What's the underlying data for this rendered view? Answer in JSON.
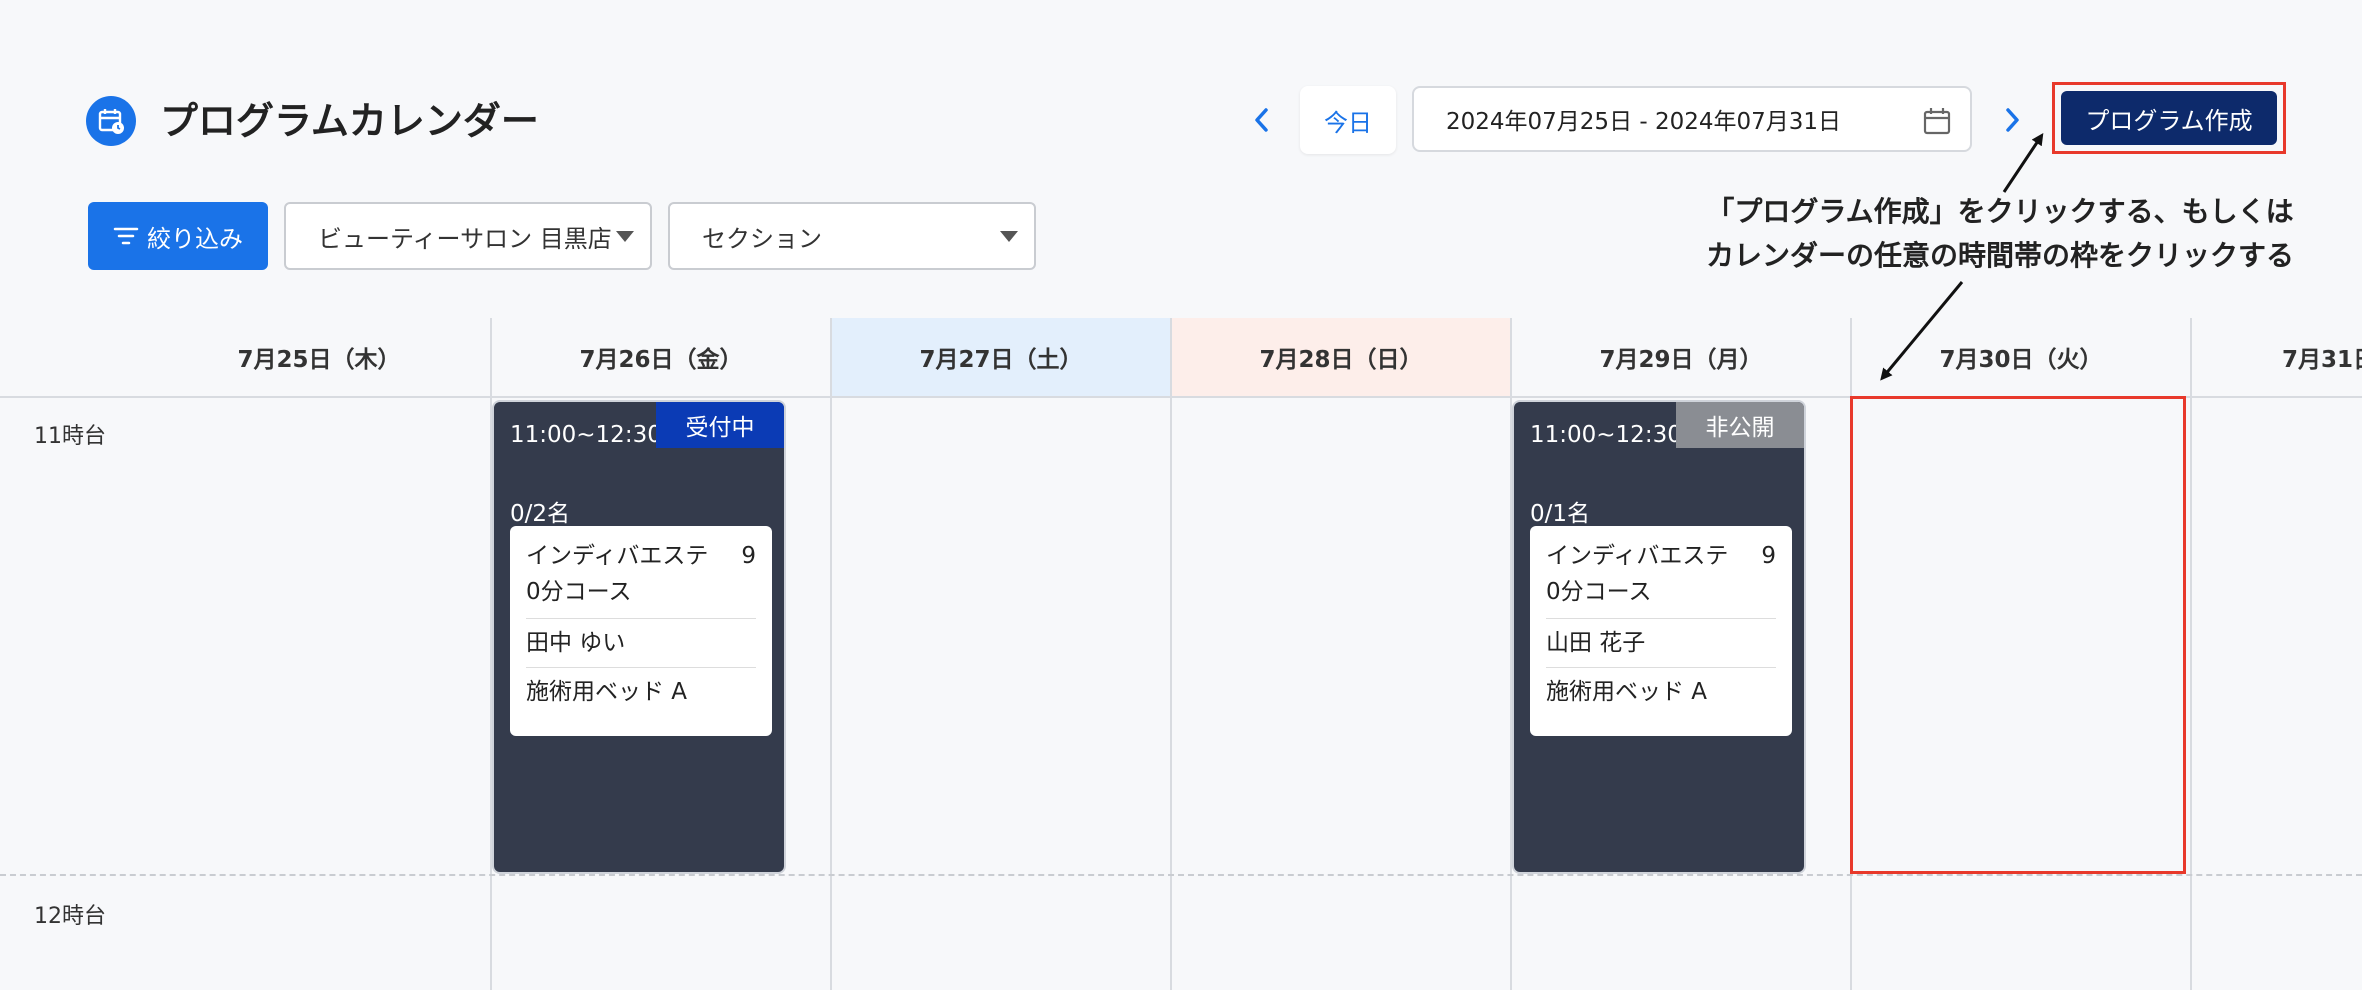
{
  "header": {
    "title": "プログラムカレンダー",
    "today_label": "今日",
    "date_range": "2024年07月25日 - 2024年07月31日",
    "create_label": "プログラム作成"
  },
  "filters": {
    "filter_label": "絞り込み",
    "store": "ビューティーサロン 目黒店",
    "section": "セクション"
  },
  "annotation": {
    "line1": "「プログラム作成」をクリックする、もしくは",
    "line2": "カレンダーの任意の時間帯の枠をクリックする"
  },
  "calendar": {
    "days": [
      "7月25日（木）",
      "7月26日（金）",
      "7月27日（土）",
      "7月28日（日）",
      "7月29日（月）",
      "7月30日（火）",
      "7月31日"
    ],
    "hours": [
      "11時台",
      "12時台"
    ],
    "events": [
      {
        "time": "11:00~12:30",
        "status": "受付中",
        "count": "0/2名",
        "course_a": "インディバエステ",
        "course_b": "9",
        "course_c": "0分コース",
        "staff": "田中 ゆい",
        "resource": "施術用ベッド A"
      },
      {
        "time": "11:00~12:30",
        "status": "非公開",
        "count": "0/1名",
        "course_a": "インディバエステ",
        "course_b": "9",
        "course_c": "0分コース",
        "staff": "山田 花子",
        "resource": "施術用ベッド A"
      }
    ]
  },
  "colors": {
    "primary": "#1a73e8",
    "create_button": "#0d2a6b",
    "event_bg": "#343b4c",
    "status_open": "#0b3bb5",
    "status_private": "#8a8d93",
    "saturday_bg": "#e3effc",
    "sunday_bg": "#fdeeea",
    "highlight": "#e8392b"
  }
}
